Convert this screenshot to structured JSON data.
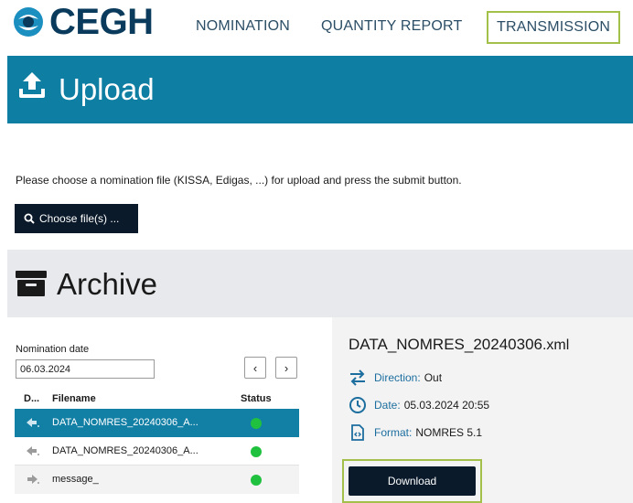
{
  "brand": {
    "name": "CEGH"
  },
  "nav": {
    "items": [
      {
        "label": "NOMINATION",
        "active": false
      },
      {
        "label": "QUANTITY REPORT",
        "active": false
      },
      {
        "label": "TRANSMISSION",
        "active": true
      }
    ]
  },
  "upload": {
    "title": "Upload",
    "hint": "Please choose a nomination file (KISSA, Edigas, ...) for upload and press the submit button.",
    "choose_label": "Choose file(s) ..."
  },
  "archive": {
    "title": "Archive",
    "date_label": "Nomination date",
    "date_value": "06.03.2024",
    "prev_label": "‹",
    "next_label": "›",
    "columns": {
      "direction": "D...",
      "filename": "Filename",
      "status": "Status"
    },
    "rows": [
      {
        "filename": "DATA_NOMRES_20240306_A...",
        "direction_icon": "arrow-left-icon",
        "status": "green",
        "selected": true
      },
      {
        "filename": "DATA_NOMRES_20240306_A...",
        "direction_icon": "arrow-left-icon",
        "status": "green",
        "selected": false
      },
      {
        "filename": "message_",
        "direction_icon": "arrow-right-icon",
        "status": "green",
        "selected": false
      }
    ]
  },
  "detail": {
    "title_main": "DATA_NOMRES_20240306",
    "title_ext": ".xml",
    "direction_label": "Direction:",
    "direction_value": "Out",
    "date_label": "Date:",
    "date_value": "05.03.2024 20:55",
    "format_label": "Format:",
    "format_value": "NOMRES 5.1",
    "download_label": "Download"
  },
  "colors": {
    "primary": "#0f7ea3",
    "accent_outline": "#a3c14a",
    "status_ok": "#21c140",
    "dark_button": "#0a1a2a"
  }
}
